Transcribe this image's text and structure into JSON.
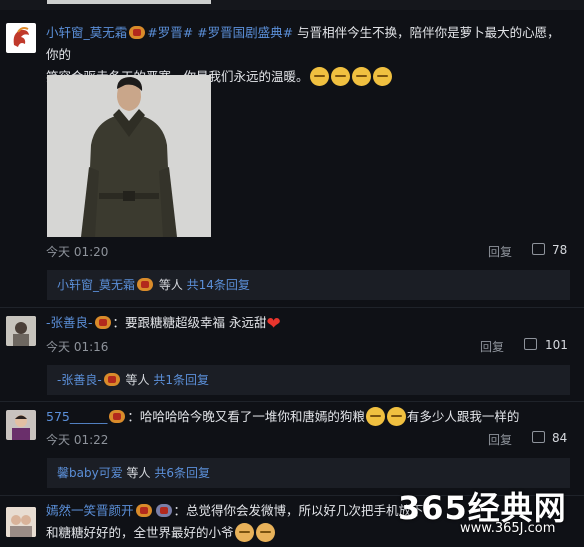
{
  "comments": [
    {
      "username": "小轩窗_莫无霜",
      "tags": "#罗晋# #罗晋国剧盛典#",
      "text_line1": " 与晋相伴今生不换，陪伴你是萝卜最大的心愿，你的",
      "text_line2": "笑容会驱走冬天的严寒，你是我们永远的温暖。",
      "time": "今天 01:20",
      "reply_label": "回复",
      "likes": "78",
      "thread": {
        "user": "小轩窗_莫无霜",
        "etc": " 等人 ",
        "count": "共14条回复"
      }
    },
    {
      "username": "-张善良-",
      "text_line1": "：要跟糖糖超级幸福 永远甜",
      "time": "今天 01:16",
      "reply_label": "回复",
      "likes": "101",
      "thread": {
        "user": "-张善良-",
        "etc": " 等人 ",
        "count": "共1条回复"
      }
    },
    {
      "username": "575______",
      "text_line1": "：哈哈哈哈今晚又看了一堆你和唐嫣的狗粮",
      "text_line1b": "有多少人跟我一样的",
      "time": "今天 01:22",
      "reply_label": "回复",
      "likes": "84",
      "thread": {
        "user": "馨baby可爱",
        "etc": " 等人 ",
        "count": "共6条回复"
      }
    },
    {
      "username": "嫣然一笑晋颜开",
      "text_line1": "：总觉得你会发微博，所以好几次把手机放下",
      "text_line2": "和糖糖好好的，全世界最好的小爷"
    }
  ],
  "watermark": {
    "big": "365经典网",
    "small": "www.365J.com"
  }
}
